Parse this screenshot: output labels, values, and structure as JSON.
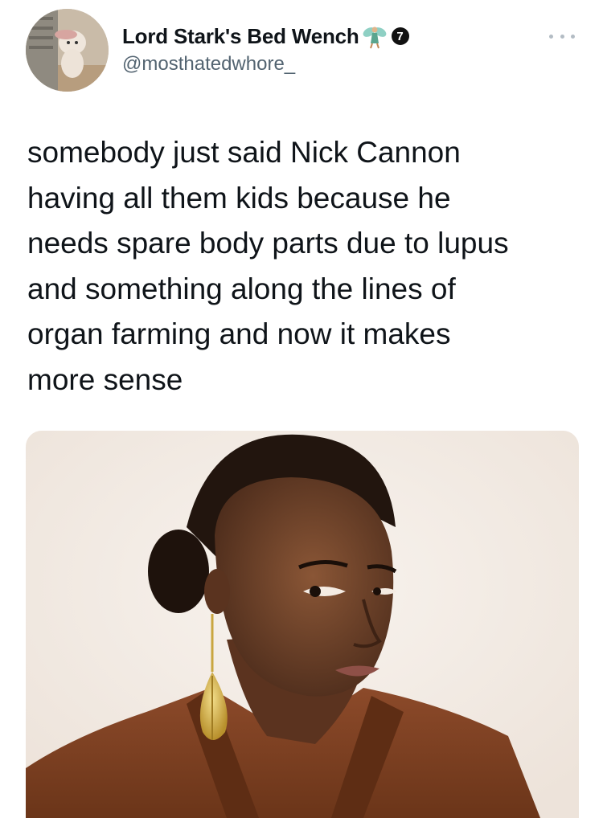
{
  "tweet": {
    "author": {
      "display_name": "Lord Stark's Bed Wench",
      "name_emoji": "fairy-emoji",
      "verified_badge": "7",
      "handle": "@mosthatedwhore_"
    },
    "more_menu_icon": "more-horizontal-icon",
    "text_lines": [
      "somebody just said Nick Cannon",
      "having all them kids because he",
      "needs spare body parts due to lupus",
      "and something along the lines of",
      "organ farming and now it makes",
      "more sense"
    ],
    "media": {
      "type": "photo",
      "subject": "woman in brown blazer with gold leaf earring glancing sideways"
    }
  },
  "colors": {
    "text": "#0f1419",
    "secondary": "#536471",
    "background": "#ffffff"
  }
}
